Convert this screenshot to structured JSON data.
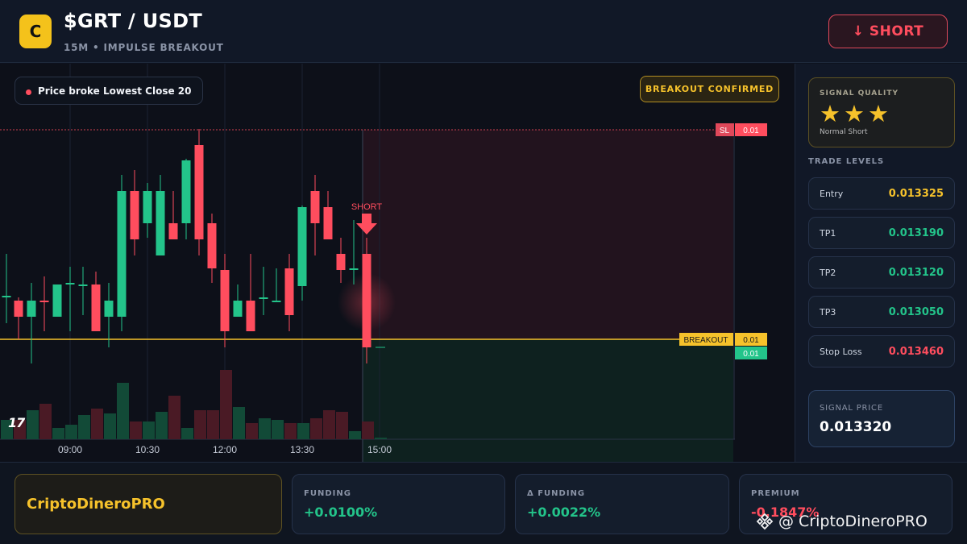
{
  "header": {
    "logo_letter": "C",
    "pair": "$GRT / USDT",
    "subtitle": "15M • IMPULSE BREAKOUT",
    "short_button": "↓ SHORT"
  },
  "chart": {
    "signal_pill": "Price broke Lowest Close 20",
    "confirmed_badge": "BREAKOUT CONFIRMED",
    "short_marker": "SHORT",
    "sl_tag": "SL",
    "sl_value": "0.01",
    "breakout_tag": "BREAKOUT",
    "breakout_value": "0.01",
    "current_value": "0.01",
    "time_labels": [
      "09:00",
      "10:30",
      "12:00",
      "13:30",
      "15:00"
    ],
    "tv_logo": "17",
    "colors": {
      "up": "#23c48a",
      "down": "#ff4d5e",
      "breakout": "#f6c22b"
    }
  },
  "chart_data": {
    "type": "candlestick",
    "candles": [
      {
        "dir": "up"
      },
      {
        "dir": "down"
      },
      {
        "dir": "up"
      },
      {
        "dir": "down"
      },
      {
        "dir": "up"
      },
      {
        "dir": "up"
      },
      {
        "dir": "up"
      },
      {
        "dir": "down"
      },
      {
        "dir": "up"
      },
      {
        "dir": "up"
      },
      {
        "dir": "down"
      },
      {
        "dir": "up"
      },
      {
        "dir": "up"
      },
      {
        "dir": "down"
      },
      {
        "dir": "up"
      },
      {
        "dir": "down"
      },
      {
        "dir": "down"
      },
      {
        "dir": "down"
      },
      {
        "dir": "up"
      },
      {
        "dir": "down"
      },
      {
        "dir": "up"
      },
      {
        "dir": "up"
      },
      {
        "dir": "down"
      },
      {
        "dir": "up"
      },
      {
        "dir": "down"
      },
      {
        "dir": "down"
      },
      {
        "dir": "down"
      },
      {
        "dir": "up"
      },
      {
        "dir": "down"
      }
    ],
    "x_tick_labels": [
      "09:00",
      "10:30",
      "12:00",
      "13:30",
      "15:00"
    ]
  },
  "sidebar": {
    "quality_label": "SIGNAL QUALITY",
    "stars": "★★★",
    "quality_sub": "Normal Short",
    "levels_title": "TRADE LEVELS",
    "levels": [
      {
        "name": "Entry",
        "value": "0.013325",
        "color": "#f6c22b"
      },
      {
        "name": "TP1",
        "value": "0.013190",
        "color": "#23c48a"
      },
      {
        "name": "TP2",
        "value": "0.013120",
        "color": "#23c48a"
      },
      {
        "name": "TP3",
        "value": "0.013050",
        "color": "#23c48a"
      },
      {
        "name": "Stop Loss",
        "value": "0.013460",
        "color": "#ff4d5e"
      }
    ],
    "signal_price_label": "SIGNAL PRICE",
    "signal_price": "0.013320"
  },
  "footer": {
    "brand": "CriptoDineroPRO",
    "stats": [
      {
        "label": "FUNDING",
        "value": "+0.0100%",
        "color": "#23c48a"
      },
      {
        "label": "Δ FUNDING",
        "value": "+0.0022%",
        "color": "#23c48a"
      },
      {
        "label": "PREMIUM",
        "value": "-0.1847%",
        "color": "#ff4d5e"
      }
    ],
    "watermark": "@ CriptoDineroPRO"
  }
}
